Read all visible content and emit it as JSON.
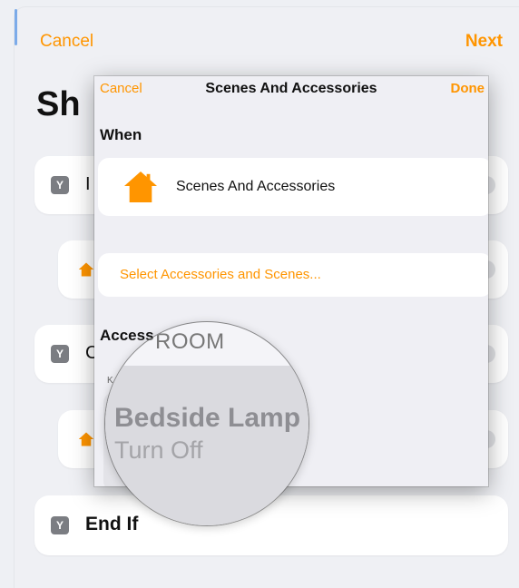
{
  "background": {
    "cancel_label": "Cancel",
    "next_label": "Next",
    "title_peek": "Sh",
    "card1_peek": "I",
    "card3_peek": "C",
    "end_if_label": "End If",
    "if_icon_glyph": "Y"
  },
  "modal": {
    "cancel_label": "Cancel",
    "title": "Scenes And Accessories",
    "done_label": "Done",
    "when_heading": "When",
    "selected_item_label": "Scenes And Accessories",
    "select_link_label": "Select Accessories and Scenes...",
    "accessories_heading": "Access",
    "room_abbrev": "K"
  },
  "magnifier": {
    "room_label": "ROOM",
    "accessory_name": "Bedside Lamp",
    "accessory_status": "Turn Off"
  },
  "colors": {
    "accent": "#ff9500",
    "home_icon": "#ff9500"
  },
  "icons": [
    "home-icon",
    "if-condition-icon",
    "drag-handle-icon"
  ]
}
